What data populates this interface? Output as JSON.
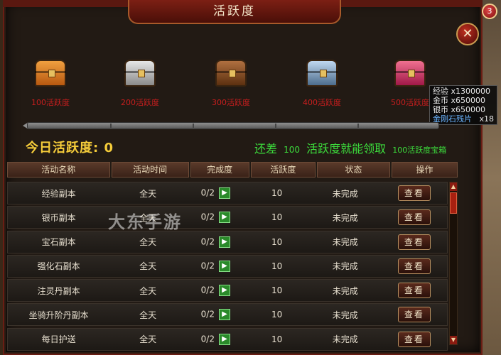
{
  "window": {
    "title": "活跃度",
    "badge": "3",
    "close_glyph": "✕"
  },
  "chests": [
    {
      "label": "100活跃度",
      "color": "orange"
    },
    {
      "label": "200活跃度",
      "color": "silver"
    },
    {
      "label": "300活跃度",
      "color": "bronze"
    },
    {
      "label": "400活跃度",
      "color": "steel-blue"
    },
    {
      "label": "500活跃度",
      "color": "pink"
    }
  ],
  "tooltip": {
    "lines": [
      "经验 x1300000",
      "金币 x650000",
      "银币 x650000"
    ],
    "item": "金刚石残片",
    "item_count": "x18"
  },
  "progress": {
    "value": 0,
    "max": 500
  },
  "today": {
    "label": "今日活跃度:",
    "value": "0"
  },
  "remain": {
    "prefix": "还差",
    "amount": "100",
    "middle": "活跃度就能领取",
    "reward": "100活跃度宝箱"
  },
  "table": {
    "headers": [
      "活动名称",
      "活动时间",
      "完成度",
      "活跃度",
      "状态",
      "操作"
    ],
    "go_glyph": "▶",
    "rows": [
      {
        "name": "经验副本",
        "time": "全天",
        "progress": "0/2",
        "points": "10",
        "status": "未完成",
        "action": "查看"
      },
      {
        "name": "银币副本",
        "time": "全天",
        "progress": "0/2",
        "points": "10",
        "status": "未完成",
        "action": "查看"
      },
      {
        "name": "宝石副本",
        "time": "全天",
        "progress": "0/2",
        "points": "10",
        "status": "未完成",
        "action": "查看"
      },
      {
        "name": "强化石副本",
        "time": "全天",
        "progress": "0/2",
        "points": "10",
        "status": "未完成",
        "action": "查看"
      },
      {
        "name": "注灵丹副本",
        "time": "全天",
        "progress": "0/2",
        "points": "10",
        "status": "未完成",
        "action": "查看"
      },
      {
        "name": "坐骑升阶丹副本",
        "time": "全天",
        "progress": "0/2",
        "points": "10",
        "status": "未完成",
        "action": "查看"
      },
      {
        "name": "每日护送",
        "time": "全天",
        "progress": "0/2",
        "points": "10",
        "status": "未完成",
        "action": "查看"
      }
    ]
  },
  "scroll": {
    "up_glyph": "▲",
    "down_glyph": "▼"
  },
  "watermark": "大东手游"
}
